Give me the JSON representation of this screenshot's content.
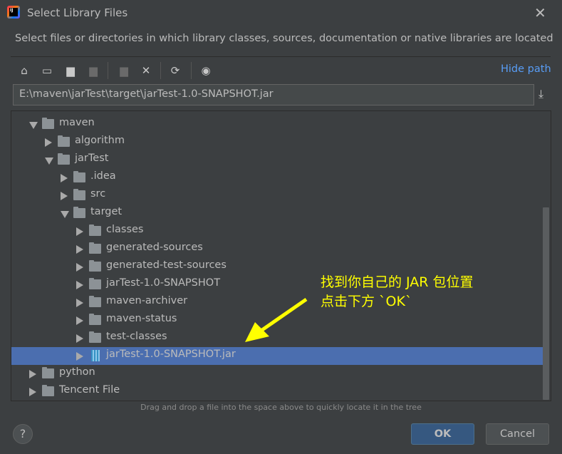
{
  "window": {
    "title": "Select Library Files",
    "close_icon": "close-icon"
  },
  "description": "Select files or directories in which library classes, sources, documentation or native libraries are located",
  "toolbar": {
    "buttons": [
      {
        "icon": "home-icon",
        "glyph": "⌂",
        "enabled": true
      },
      {
        "icon": "desktop-icon",
        "glyph": "▭",
        "enabled": true
      },
      {
        "icon": "project-folder-icon",
        "glyph": "▆",
        "enabled": true
      },
      {
        "icon": "module-folder-icon",
        "glyph": "▆",
        "enabled": false
      },
      {
        "icon": "new-folder-icon",
        "glyph": "▆",
        "enabled": false
      },
      {
        "icon": "delete-icon",
        "glyph": "✕",
        "enabled": true
      },
      {
        "icon": "refresh-icon",
        "glyph": "⟳",
        "enabled": true
      },
      {
        "icon": "show-hidden-icon",
        "glyph": "◉",
        "enabled": true
      }
    ],
    "hide_path": "Hide path"
  },
  "path": {
    "value": "E:\\maven\\jarTest\\target\\jarTest-1.0-SNAPSHOT.jar",
    "download_icon": "download-icon"
  },
  "tree": [
    {
      "label": "maven",
      "level": 0,
      "state": "expanded",
      "type": "folder"
    },
    {
      "label": "algorithm",
      "level": 1,
      "state": "collapsed",
      "type": "folder"
    },
    {
      "label": "jarTest",
      "level": 1,
      "state": "expanded",
      "type": "folder"
    },
    {
      "label": ".idea",
      "level": 2,
      "state": "collapsed",
      "type": "folder"
    },
    {
      "label": "src",
      "level": 2,
      "state": "collapsed",
      "type": "folder"
    },
    {
      "label": "target",
      "level": 2,
      "state": "expanded",
      "type": "folder"
    },
    {
      "label": "classes",
      "level": 3,
      "state": "collapsed",
      "type": "folder"
    },
    {
      "label": "generated-sources",
      "level": 3,
      "state": "collapsed",
      "type": "folder"
    },
    {
      "label": "generated-test-sources",
      "level": 3,
      "state": "collapsed",
      "type": "folder"
    },
    {
      "label": "jarTest-1.0-SNAPSHOT",
      "level": 3,
      "state": "collapsed",
      "type": "folder"
    },
    {
      "label": "maven-archiver",
      "level": 3,
      "state": "collapsed",
      "type": "folder"
    },
    {
      "label": "maven-status",
      "level": 3,
      "state": "collapsed",
      "type": "folder"
    },
    {
      "label": "test-classes",
      "level": 3,
      "state": "collapsed",
      "type": "folder"
    },
    {
      "label": "jarTest-1.0-SNAPSHOT.jar",
      "level": 3,
      "state": "collapsed",
      "type": "jar",
      "selected": true
    },
    {
      "label": "python",
      "level": 0,
      "state": "collapsed",
      "type": "folder"
    },
    {
      "label": "Tencent File",
      "level": 0,
      "state": "collapsed",
      "type": "folder"
    }
  ],
  "hint": "Drag and drop a file into the space above to quickly locate it in the tree",
  "annotation": {
    "text": "找到你自己的 JAR 包位置\n点击下方 `OK`",
    "color": "#ffff00"
  },
  "buttons": {
    "help": "?",
    "ok": "OK",
    "cancel": "Cancel"
  },
  "colors": {
    "background": "#3c3f41",
    "selection": "#4b6eaf",
    "link": "#589df6",
    "ok_button": "#365880"
  }
}
